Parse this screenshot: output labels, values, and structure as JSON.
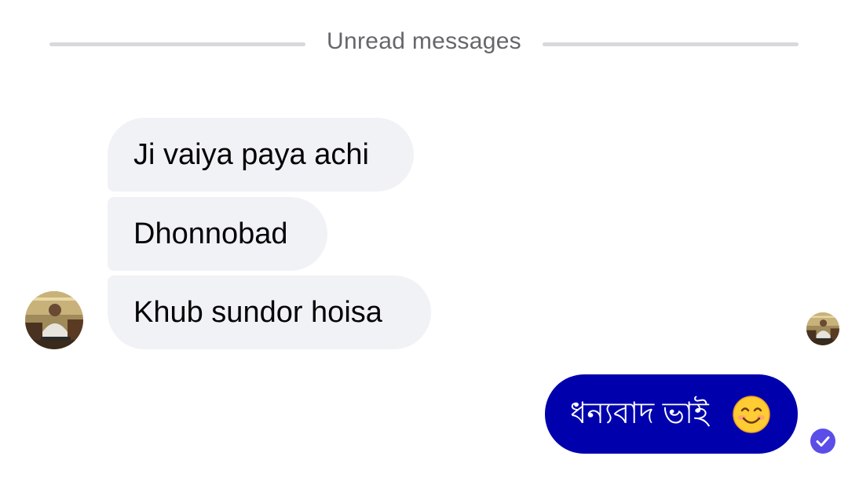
{
  "divider": {
    "label": "Unread messages"
  },
  "incoming": {
    "sender_avatar": "sender-avatar",
    "messages": [
      {
        "text": "Ji vaiya paya achi"
      },
      {
        "text": "Dhonnobad"
      },
      {
        "text": "Khub sundor hoisa"
      }
    ]
  },
  "outgoing": {
    "messages": [
      {
        "text": "ধন্যবাদ ভাই",
        "emoji": "smiling-face-icon"
      }
    ],
    "status": "check-circle-icon",
    "seen_by_avatar": "seen-avatar"
  },
  "colors": {
    "incoming_bubble": "#f1f2f6",
    "outgoing_bubble": "#0000ad",
    "status_check": "#5b4de8",
    "divider": "#d8d9dc",
    "divider_text": "#65676b"
  }
}
